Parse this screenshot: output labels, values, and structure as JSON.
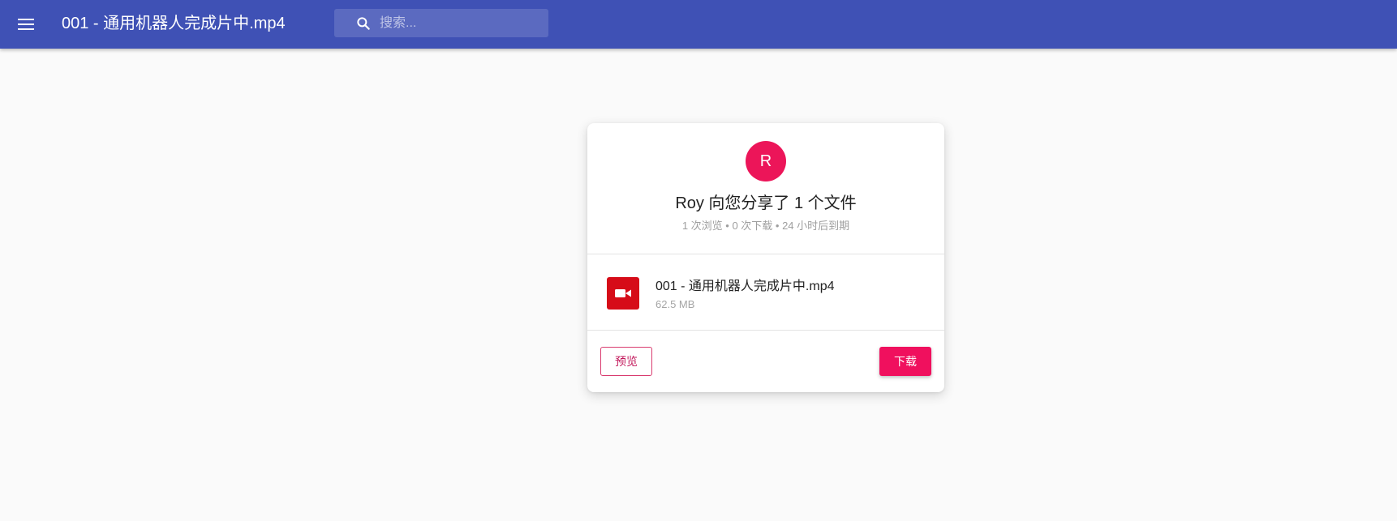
{
  "appbar": {
    "title": "001 - 通用机器人完成片中.mp4",
    "search_placeholder": "搜索...",
    "color": "#3f51b5"
  },
  "share": {
    "avatar_letter": "R",
    "avatar_color": "#ec1559",
    "title": "Roy 向您分享了 1 个文件",
    "stats": "1 次浏览 • 0 次下载 • 24 小时后到期"
  },
  "file": {
    "name": "001 - 通用机器人完成片中.mp4",
    "size": "62.5 MB",
    "icon": "video-camera-icon",
    "icon_color": "#d60c18"
  },
  "actions": {
    "preview_label": "预览",
    "download_label": "下载",
    "accent": "#f0105e"
  }
}
